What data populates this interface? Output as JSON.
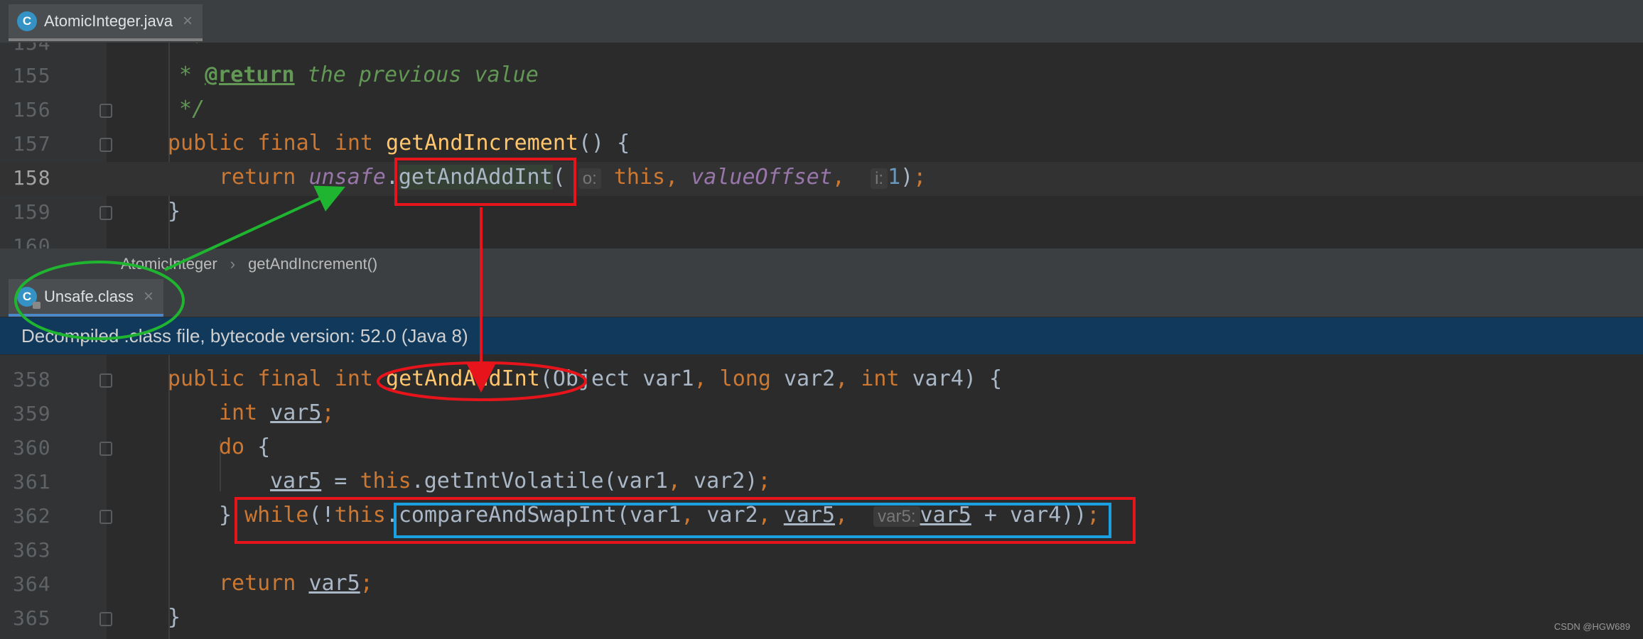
{
  "tabs": {
    "top": {
      "label": "AtomicInteger.java",
      "icon": "class-icon",
      "icon_letter": "C"
    },
    "bottom": {
      "label": "Unsafe.class",
      "icon": "class-locked-icon",
      "icon_letter": "C"
    }
  },
  "editor1": {
    "lines": [
      {
        "num": "155",
        "text": " * @return the previous value"
      },
      {
        "num": "156",
        "text": " */"
      },
      {
        "num": "157",
        "text": "public final int getAndIncrement() {"
      },
      {
        "num": "158",
        "text": "    return unsafe.getAndAddInt( o: this, valueOffset,  i: 1);"
      },
      {
        "num": "159",
        "text": "}"
      }
    ],
    "hints": {
      "o": "o:",
      "i": "i:"
    }
  },
  "breadcrumb": {
    "class": "AtomicInteger",
    "method": "getAndIncrement()"
  },
  "banner": {
    "text": "Decompiled .class file, bytecode version: 52.0 (Java 8)"
  },
  "editor2": {
    "lines": [
      {
        "num": "358",
        "text": "public final int getAndAddInt(Object var1, long var2, int var4) {"
      },
      {
        "num": "359",
        "text": "    int var5;"
      },
      {
        "num": "360",
        "text": "    do {"
      },
      {
        "num": "361",
        "text": "        var5 = this.getIntVolatile(var1, var2);"
      },
      {
        "num": "362",
        "text": "    } while(!this.compareAndSwapInt(var1, var2, var5,  var5: var5 + var4));"
      },
      {
        "num": "363",
        "text": ""
      },
      {
        "num": "364",
        "text": "    return var5;"
      },
      {
        "num": "365",
        "text": "}"
      }
    ],
    "hints": {
      "var5": "var5:"
    }
  },
  "watermark": "CSDN @HGW689",
  "colors": {
    "annotation_red": "#e8141c",
    "annotation_green": "#1fb530",
    "annotation_blue": "#1aa0e0"
  }
}
